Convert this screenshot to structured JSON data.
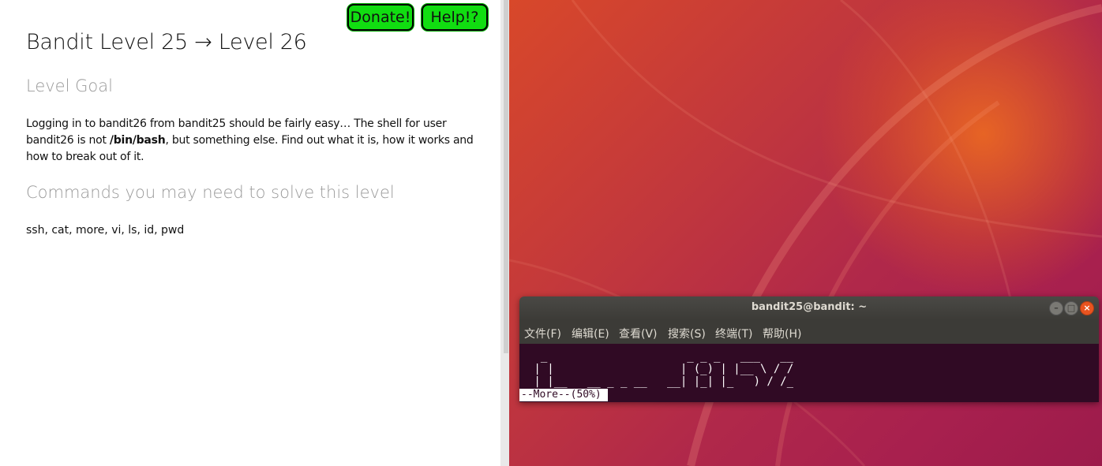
{
  "page": {
    "donate_label": "Donate!",
    "help_label": "Help!?",
    "title": "Bandit Level 25 → Level 26",
    "goal_heading": "Level Goal",
    "goal_text_1": "Logging in to bandit26 from bandit25 should be fairly easy… The shell for user bandit26 is not ",
    "goal_text_bold": "/bin/bash",
    "goal_text_2": ", but something else. Find out what it is, how it works and how to break out of it.",
    "commands_heading": "Commands you may need to solve this level",
    "commands_text": "ssh, cat, more, vi, ls, id, pwd"
  },
  "terminal": {
    "title": "bandit25@bandit: ~",
    "buttons": {
      "minimize": "–",
      "maximize": "□",
      "close": "×"
    },
    "menu": [
      "文件(F)",
      "编辑(E)",
      "查看(V)",
      "搜索(S)",
      "终端(T)",
      "帮助(H)"
    ],
    "ascii_art": "  _                     _ _ _   ___   __\n | |                   | (_) | |__ \\ / /\n | |__   __ _ _ __   __| |_| |_   ) / /_",
    "status": "--More--(50%)"
  },
  "colors": {
    "button_green": "#11dd11",
    "terminal_bg": "#300a24",
    "desktop_orange": "#e95420",
    "desktop_purple": "#9c1b4b"
  }
}
